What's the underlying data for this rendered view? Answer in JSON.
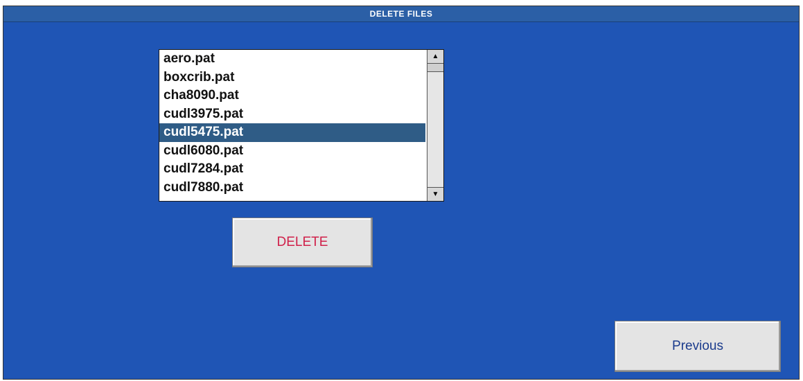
{
  "window": {
    "title": "DELETE FILES"
  },
  "file_list": {
    "items": [
      {
        "label": "aero.pat",
        "selected": false
      },
      {
        "label": "boxcrib.pat",
        "selected": false
      },
      {
        "label": "cha8090.pat",
        "selected": false
      },
      {
        "label": "cudl3975.pat",
        "selected": false
      },
      {
        "label": "cudl5475.pat",
        "selected": true
      },
      {
        "label": "cudl6080.pat",
        "selected": false
      },
      {
        "label": "cudl7284.pat",
        "selected": false
      },
      {
        "label": "cudl7880.pat",
        "selected": false
      }
    ],
    "scroll_up_icon": "arrow-up-icon",
    "scroll_down_icon": "arrow-down-icon"
  },
  "buttons": {
    "delete_label": "DELETE",
    "previous_label": "Previous"
  },
  "colors": {
    "background": "#1f55b5",
    "selection": "#2f5c86",
    "delete_text": "#d0204a",
    "previous_text": "#1a3b8c"
  }
}
